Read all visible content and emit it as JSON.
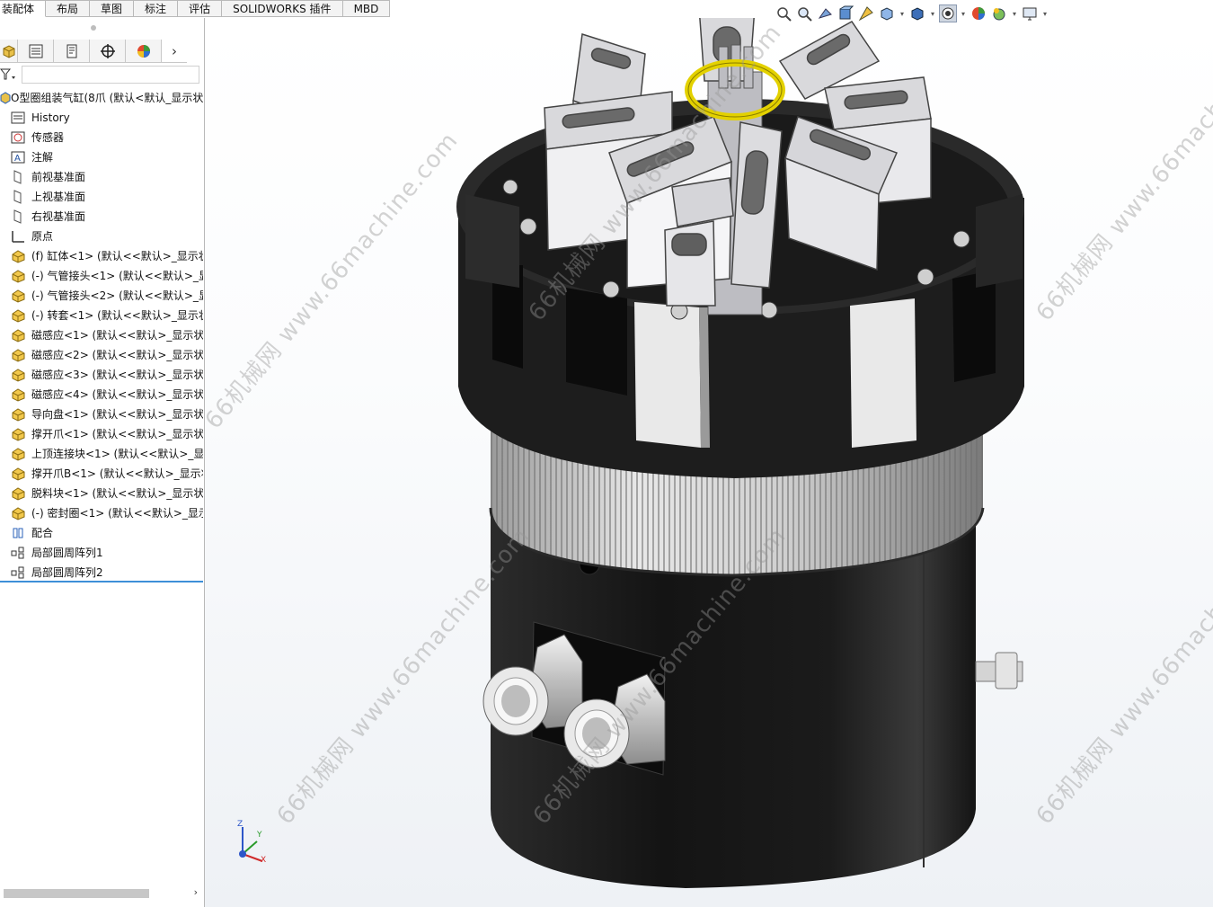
{
  "tabs": [
    {
      "label": "装配体",
      "active": true
    },
    {
      "label": "布局"
    },
    {
      "label": "草图"
    },
    {
      "label": "标注"
    },
    {
      "label": "评估"
    },
    {
      "label": "SOLIDWORKS 插件"
    },
    {
      "label": "MBD"
    }
  ],
  "hud_icons": [
    "zoom-to-fit-icon",
    "zoom-to-area-icon",
    "previous-view-icon",
    "section-view-icon",
    "dynamic-annotation-icon",
    "view-orientation-icon",
    "display-style-icon",
    "hide-show-items-icon",
    "edit-appearance-icon",
    "apply-scene-icon",
    "view-settings-icon"
  ],
  "panel_tabs": [
    "feature-manager-icon",
    "property-manager-icon",
    "configuration-manager-icon",
    "dimxpert-manager-icon",
    "display-manager-icon"
  ],
  "tree": {
    "root": "O型圈组装气缸(8爪 (默认<默认_显示状",
    "items": [
      {
        "label": "History",
        "icon": "history"
      },
      {
        "label": "传感器",
        "icon": "sensor"
      },
      {
        "label": "注解",
        "icon": "annotation"
      },
      {
        "label": "前视基准面",
        "icon": "plane"
      },
      {
        "label": "上视基准面",
        "icon": "plane"
      },
      {
        "label": "右视基准面",
        "icon": "plane"
      },
      {
        "label": "原点",
        "icon": "origin"
      },
      {
        "label": "(f) 缸体<1> (默认<<默认>_显示状",
        "icon": "part"
      },
      {
        "label": "(-) 气管接头<1> (默认<<默认>_显",
        "icon": "part"
      },
      {
        "label": "(-) 气管接头<2> (默认<<默认>_显",
        "icon": "part"
      },
      {
        "label": "(-) 转套<1> (默认<<默认>_显示状",
        "icon": "part"
      },
      {
        "label": "磁感应<1> (默认<<默认>_显示状:",
        "icon": "part"
      },
      {
        "label": "磁感应<2> (默认<<默认>_显示状:",
        "icon": "part"
      },
      {
        "label": "磁感应<3> (默认<<默认>_显示状:",
        "icon": "part"
      },
      {
        "label": "磁感应<4> (默认<<默认>_显示状:",
        "icon": "part"
      },
      {
        "label": "导向盘<1> (默认<<默认>_显示状:",
        "icon": "part"
      },
      {
        "label": "撑开爪<1> (默认<<默认>_显示状:",
        "icon": "part"
      },
      {
        "label": "上顶连接块<1> (默认<<默认>_显示",
        "icon": "part"
      },
      {
        "label": "撑开爪B<1> (默认<<默认>_显示状",
        "icon": "part"
      },
      {
        "label": "脱料块<1> (默认<<默认>_显示状:",
        "icon": "part"
      },
      {
        "label": "(-) 密封圈<1> (默认<<默认>_显示",
        "icon": "part"
      },
      {
        "label": "配合",
        "icon": "mates"
      },
      {
        "label": "局部圆周阵列1",
        "icon": "pattern"
      },
      {
        "label": "局部圆周阵列2",
        "icon": "pattern"
      }
    ]
  },
  "watermark": "66机械网 www.66machine.com",
  "triad": {
    "x": "X",
    "y": "Y",
    "z": "Z"
  },
  "colors": {
    "accent": "#3d8fd8",
    "cylinder": "#1f1f1f",
    "claw": "#d9d9dc",
    "seal": "#e3d100"
  }
}
